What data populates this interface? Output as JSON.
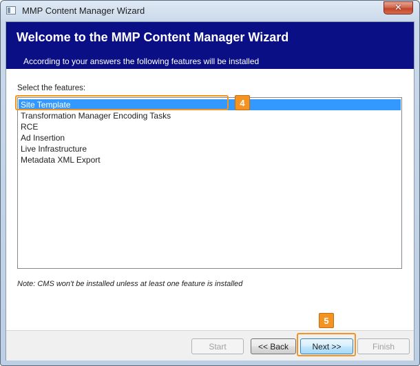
{
  "window": {
    "title": "MMP Content Manager Wizard",
    "close_icon": "close-icon",
    "app_icon": "application-icon"
  },
  "header": {
    "title": "Welcome to the MMP Content Manager Wizard",
    "subtitle": "According to your answers the following features will be installed",
    "background_color": "#0b0f86"
  },
  "features": {
    "label": "Select the features:",
    "selected_index": 0,
    "items": [
      {
        "label": "Site Template"
      },
      {
        "label": "Transformation Manager Encoding Tasks"
      },
      {
        "label": "RCE"
      },
      {
        "label": "Ad Insertion"
      },
      {
        "label": "Live Infrastructure"
      },
      {
        "label": "Metadata XML Export"
      }
    ],
    "selection_color": "#3399ff"
  },
  "note": "Note: CMS won't be installed unless at least one feature is installed",
  "buttons": {
    "start": {
      "label": "Start",
      "enabled": false
    },
    "back": {
      "label": "<< Back",
      "enabled": true
    },
    "next": {
      "label": "Next >>",
      "enabled": true
    },
    "finish": {
      "label": "Finish",
      "enabled": false
    }
  },
  "callouts": [
    {
      "number": "4",
      "target": "Site Template"
    },
    {
      "number": "5",
      "target": "Next >>"
    }
  ],
  "colors": {
    "callout": "#f39322"
  }
}
